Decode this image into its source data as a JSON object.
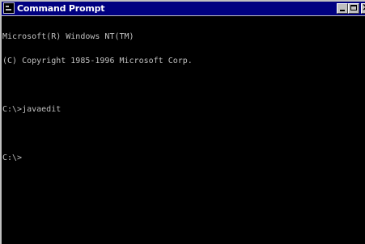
{
  "window": {
    "title": "Command Prompt",
    "icon": "console-icon"
  },
  "titlebar_buttons": {
    "minimize": "minimize-icon",
    "maximize": "maximize-icon",
    "close": "close-icon"
  },
  "console": {
    "lines": [
      "Microsoft(R) Windows NT(TM)",
      "(C) Copyright 1985-1996 Microsoft Corp.",
      "",
      "C:\\>javaedit",
      "",
      "C:\\>"
    ],
    "text_color": "#c0c0c0",
    "background_color": "#000000"
  },
  "colors": {
    "titlebar": "#000080",
    "title_text": "#ffffff",
    "frame": "#c0c0c0"
  }
}
